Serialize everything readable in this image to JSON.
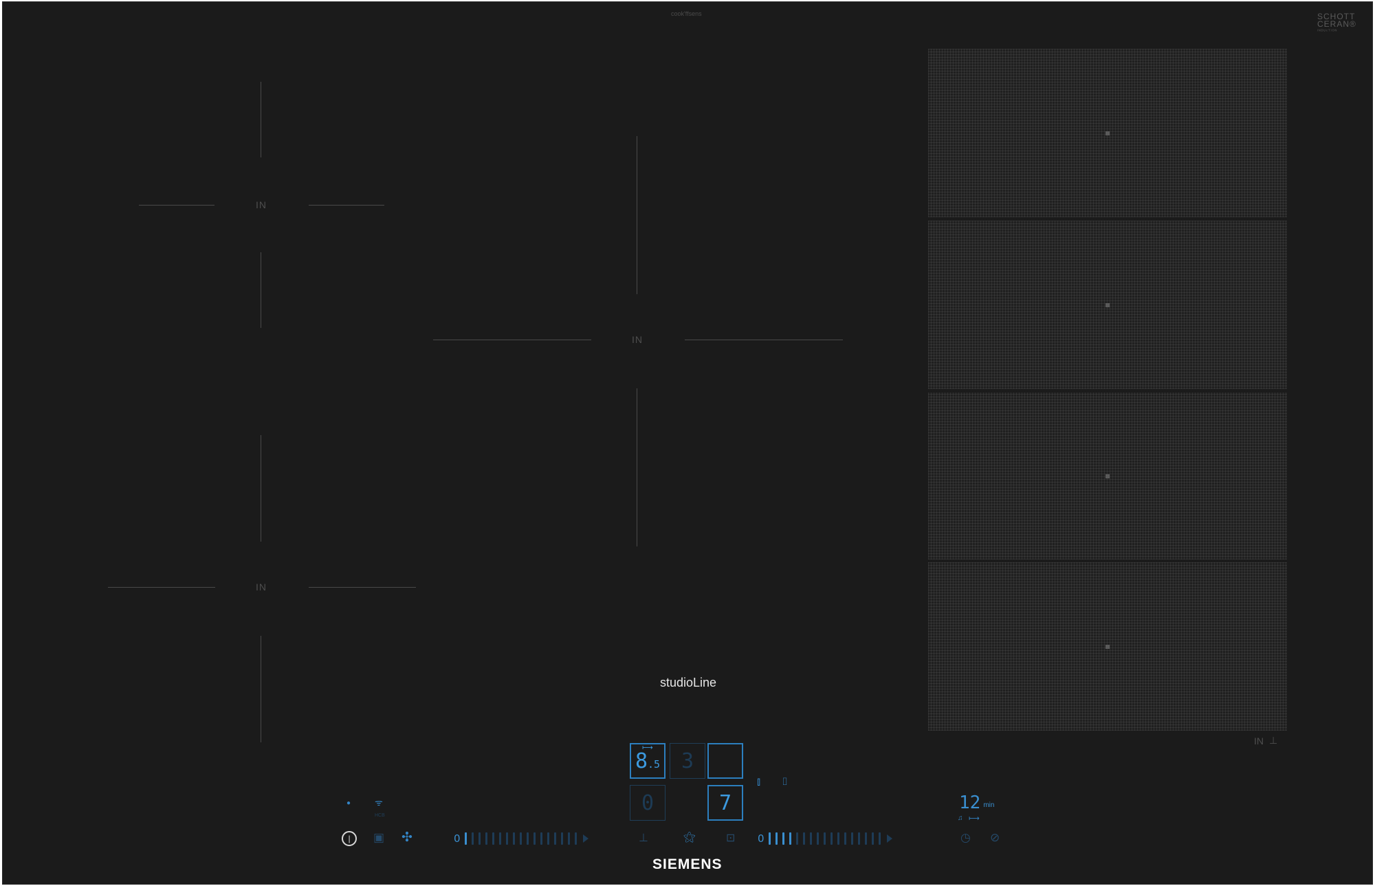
{
  "top": {
    "center_text": "cook'ffsens",
    "brand_glass_line1": "SCHOTT",
    "brand_glass_line2": "CERAN®",
    "brand_glass_line3": "ᴵᴺᴰᵁᶜᵀᴵᴼᴺ"
  },
  "zones": {
    "left_top_label": "IN",
    "left_bottom_label": "IN",
    "center_label": "IN",
    "flex_label": "IN"
  },
  "model_text": "studioLine",
  "brand_text": "SIEMENS",
  "controls": {
    "display_1": "8",
    "display_1_decimal": ".5",
    "display_2": "3",
    "display_3": "",
    "display_4": "0",
    "display_5": "7",
    "left_slider_zero": "0",
    "right_slider_zero": "0",
    "right_slider_level": 4,
    "timer_value": "12",
    "timer_unit": "min",
    "wifi_caption": "HCB"
  },
  "icons": [
    "power-icon",
    "home-connect-icon",
    "fan-icon",
    "wifi-icon",
    "boost-icon",
    "hood-icon",
    "lock-icon",
    "timer-icon",
    "stopwatch-icon",
    "pan-icon",
    "bell-icon"
  ],
  "colors": {
    "hob_black": "#1b1b1b",
    "accent_blue": "#3a8fd0",
    "dim_blue": "#1e3c57",
    "marking_grey": "#4a4a4a"
  }
}
